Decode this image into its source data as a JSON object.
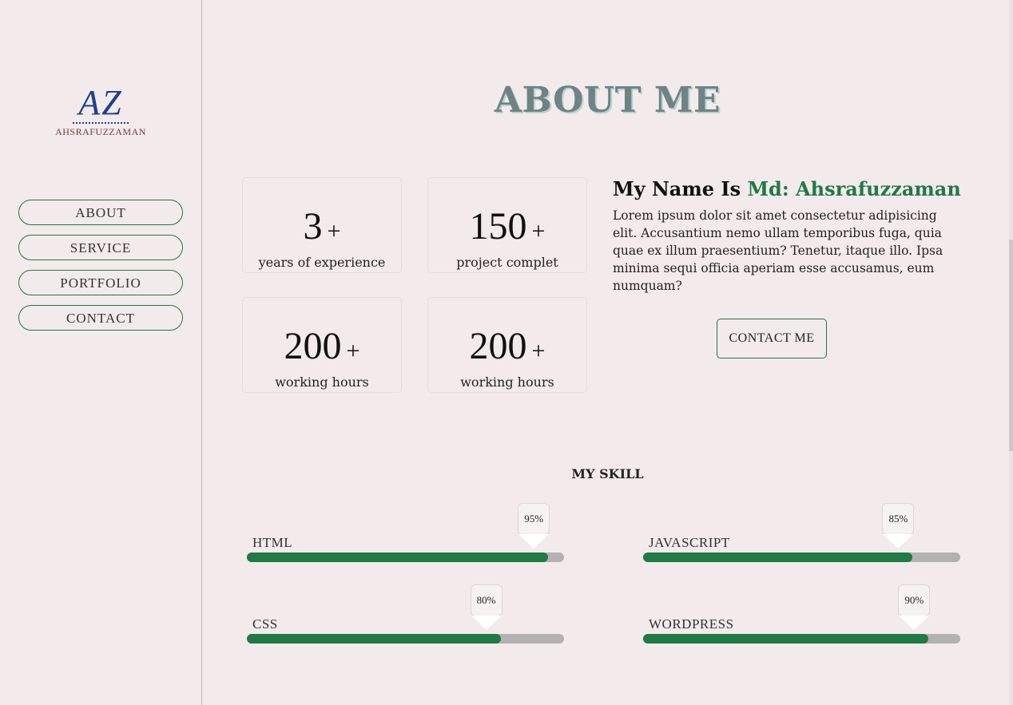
{
  "logo": {
    "mark": "AZ",
    "name": "AHSRAFUZZAMAN"
  },
  "nav": [
    "ABOUT",
    "SERVICE",
    "PORTFOLIO",
    "CONTACT"
  ],
  "page_title": "ABOUT ME",
  "stats": [
    {
      "value": "3",
      "plus": "+",
      "label": "years of experience"
    },
    {
      "value": "150",
      "plus": "+",
      "label": "project complet"
    },
    {
      "value": "200",
      "plus": "+",
      "label": "working hours"
    },
    {
      "value": "200",
      "plus": "+",
      "label": "working hours"
    }
  ],
  "about": {
    "heading_prefix": "My Name Is",
    "heading_name": "Md: Ahsrafuzzaman",
    "body": "Lorem ipsum dolor sit amet consectetur adipisicing elit. Accusantium nemo ullam temporibus fuga, quia quae ex illum praesentium? Tenetur, itaque illo. Ipsa minima sequi officia aperiam esse accusamus, eum numquam?",
    "button": "CONTACT ME"
  },
  "skills": {
    "title": "MY SKILL",
    "items": [
      {
        "name": "HTML",
        "percent": "95%",
        "fraction": 0.95
      },
      {
        "name": "JAVASCRIPT",
        "percent": "85%",
        "fraction": 0.85
      },
      {
        "name": "CSS",
        "percent": "80%",
        "fraction": 0.8
      },
      {
        "name": "WORDPRESS",
        "percent": "90%",
        "fraction": 0.9
      }
    ]
  },
  "colors": {
    "accent": "#1f7a44",
    "background": "#f3eaeb",
    "logo": "#1d3f92",
    "title": "#6e8383"
  }
}
